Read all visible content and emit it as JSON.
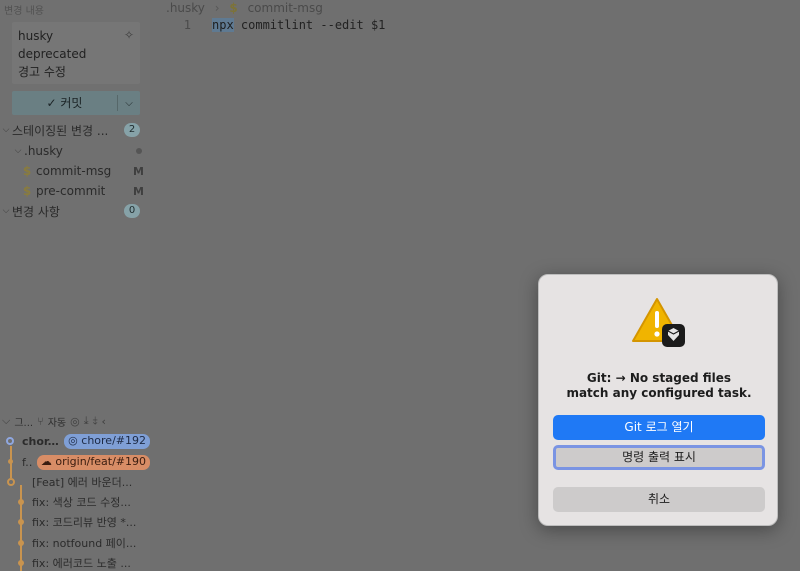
{
  "sidebar": {
    "changes_header": "변경 내용",
    "commit_message_lines": [
      "husky",
      "deprecated",
      "경고 수정"
    ],
    "commit_button_label": "커밋",
    "staged": {
      "label": "스테이징된 변경 ...",
      "count": "2"
    },
    "folder": ".husky",
    "files": [
      {
        "name": "commit-msg",
        "status": "M"
      },
      {
        "name": "pre-commit",
        "status": "M"
      }
    ],
    "changes": {
      "label": "변경 사항",
      "count": "0"
    }
  },
  "graph": {
    "header_label": "그...",
    "auto_label": "자동",
    "rows": [
      {
        "label": "chor...",
        "ref": "chore/#192"
      },
      {
        "label": "f...",
        "ref": "origin/feat/#190"
      },
      {
        "label": "[Feat] 에러 바운더..."
      },
      {
        "label": "fix: 색상 코드 수정..."
      },
      {
        "label": "fix: 코드리뷰 반영 *..."
      },
      {
        "label": "fix: notfound 페이..."
      },
      {
        "label": "fix: 에러코드 노출 ..."
      }
    ]
  },
  "editor": {
    "breadcrumb_folder": ".husky",
    "breadcrumb_file": "commit-msg",
    "line_number": "1",
    "code_highlight": "npx",
    "code_rest": " commitlint --edit $1"
  },
  "dialog": {
    "message_line1": "Git: → No staged files",
    "message_line2": "match any configured task.",
    "open_log_button": "Git 로그 열기",
    "show_output_button": "명령 출력 표시",
    "cancel_button": "취소"
  },
  "colors": {
    "primary_button": "#1f79f5",
    "warning": "#f0b400",
    "local_branch_pill": "#7f9fd6",
    "remote_branch_pill": "#d88d66",
    "graph_blue": "#8fa7e0",
    "graph_orange": "#c9944f"
  }
}
